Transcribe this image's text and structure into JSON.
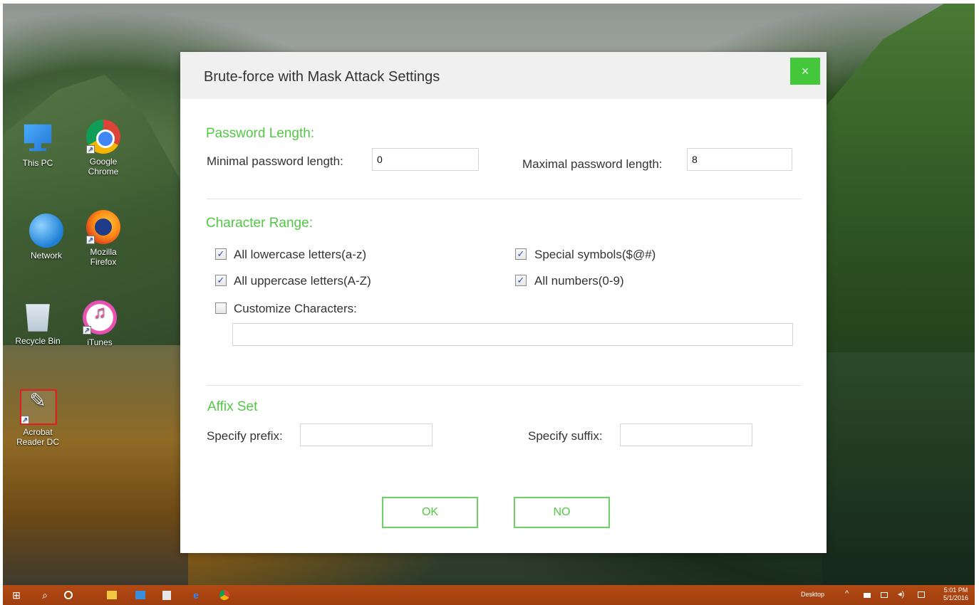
{
  "desktop": {
    "icons": [
      {
        "label": "This PC",
        "icon": "pc-icon"
      },
      {
        "label": "Google Chrome",
        "icon": "chrome-icon"
      },
      {
        "label": "Network",
        "icon": "network-icon"
      },
      {
        "label": "Mozilla Firefox",
        "icon": "firefox-icon"
      },
      {
        "label": "Recycle Bin",
        "icon": "recycle-bin-icon"
      },
      {
        "label": "iTunes",
        "icon": "itunes-icon"
      },
      {
        "label": "Acrobat Reader DC",
        "icon": "acrobat-icon"
      }
    ],
    "shortcut_glyph": "↗"
  },
  "dialog": {
    "title": "Brute-force with Mask Attack Settings",
    "close_glyph": "×",
    "password_length": {
      "title": "Password Length:",
      "min_label": "Minimal password length:",
      "min_value": "0",
      "max_label": "Maximal password length:",
      "max_value": "8"
    },
    "character_range": {
      "title": "Character Range:",
      "lowercase": {
        "label": "All lowercase letters(a-z)",
        "checked": true
      },
      "uppercase": {
        "label": "All uppercase letters(A-Z)",
        "checked": true
      },
      "special": {
        "label": "Special symbols($@#)",
        "checked": true
      },
      "numbers": {
        "label": "All numbers(0-9)",
        "checked": true
      },
      "customize": {
        "label": "Customize Characters:",
        "checked": false,
        "value": ""
      },
      "check_glyph": "✓"
    },
    "affix": {
      "title": "Affix Set",
      "prefix_label": "Specify prefix:",
      "prefix_value": "",
      "suffix_label": "Specify suffix:",
      "suffix_value": ""
    },
    "buttons": {
      "ok": "OK",
      "no": "NO"
    },
    "accent_color": "#52c844"
  },
  "taskbar": {
    "start_glyph": "⊞",
    "search_glyph": "⌕",
    "desktop_label": "Desktop",
    "time": "5:01 PM",
    "date": "5/1/2016",
    "color": "#a8430f"
  }
}
